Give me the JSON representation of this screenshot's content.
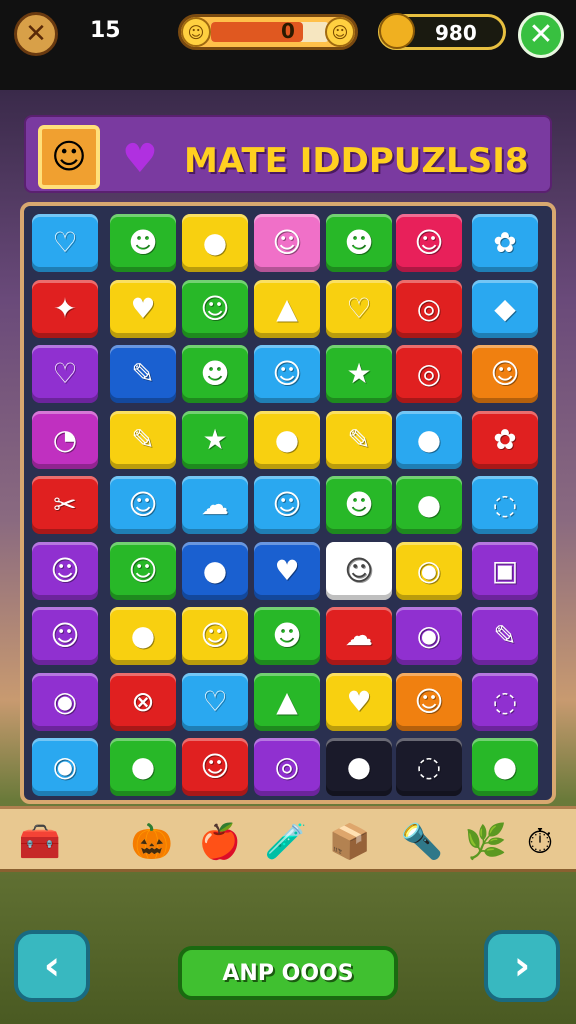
{
  "hud": {
    "moves": "15",
    "meter_value": "0",
    "meter_progress": 0.78,
    "coins": "980",
    "icons": {
      "crate": "crate-icon",
      "face_left": "smiley-icon",
      "face_right": "smiley-icon",
      "coin": "coin-bag-icon",
      "close": "close-icon"
    }
  },
  "banner": {
    "title": "MATE IDDPUZLSI8",
    "logo_icon": "cat-face-icon",
    "heart_icon": "heart-icon"
  },
  "board": {
    "rows": 9,
    "cols": 7,
    "tiles": [
      [
        {
          "c": "#2aa8f0",
          "g": "♡"
        },
        {
          "c": "#28b828",
          "g": "☻"
        },
        {
          "c": "#f8d010",
          "g": "●"
        },
        {
          "c": "#f070c8",
          "g": "☺"
        },
        {
          "c": "#28b828",
          "g": "☻"
        },
        {
          "c": "#e8205a",
          "g": "☺"
        },
        {
          "c": "#2aa8f0",
          "g": "✿"
        }
      ],
      [
        {
          "c": "#e02020",
          "g": "✦"
        },
        {
          "c": "#f8d010",
          "g": "♥"
        },
        {
          "c": "#28b828",
          "g": "☺"
        },
        {
          "c": "#f8d010",
          "g": "▲"
        },
        {
          "c": "#f8d010",
          "g": "♡"
        },
        {
          "c": "#e02020",
          "g": "◎"
        },
        {
          "c": "#2aa8f0",
          "g": "◆"
        }
      ],
      [
        {
          "c": "#9030d0",
          "g": "♡"
        },
        {
          "c": "#1a60d0",
          "g": "✎"
        },
        {
          "c": "#28b828",
          "g": "☻"
        },
        {
          "c": "#2aa8f0",
          "g": "☺"
        },
        {
          "c": "#28b828",
          "g": "★"
        },
        {
          "c": "#e02020",
          "g": "◎"
        },
        {
          "c": "#f08010",
          "g": "☺"
        }
      ],
      [
        {
          "c": "#c030c0",
          "g": "◔"
        },
        {
          "c": "#f8d010",
          "g": "✎"
        },
        {
          "c": "#28b828",
          "g": "★"
        },
        {
          "c": "#f8d010",
          "g": "●"
        },
        {
          "c": "#f8d010",
          "g": "✎"
        },
        {
          "c": "#2aa8f0",
          "g": "●"
        },
        {
          "c": "#e02020",
          "g": "✿"
        }
      ],
      [
        {
          "c": "#e02020",
          "g": "✂"
        },
        {
          "c": "#2aa8f0",
          "g": "☺"
        },
        {
          "c": "#2aa8f0",
          "g": "☁"
        },
        {
          "c": "#2aa8f0",
          "g": "☺"
        },
        {
          "c": "#28b828",
          "g": "☻"
        },
        {
          "c": "#28b828",
          "g": "●"
        },
        {
          "c": "#2aa8f0",
          "g": "◌"
        }
      ],
      [
        {
          "c": "#9030d0",
          "g": "☺"
        },
        {
          "c": "#28b828",
          "g": "☺"
        },
        {
          "c": "#1a60d0",
          "g": "●"
        },
        {
          "c": "#1a60d0",
          "g": "♥"
        },
        {
          "c": "#ffffff",
          "g": "☺"
        },
        {
          "c": "#f8d010",
          "g": "◉"
        },
        {
          "c": "#9030d0",
          "g": "▣"
        }
      ],
      [
        {
          "c": "#9030d0",
          "g": "☺"
        },
        {
          "c": "#f8d010",
          "g": "●"
        },
        {
          "c": "#f8d010",
          "g": "☺"
        },
        {
          "c": "#28b828",
          "g": "☻"
        },
        {
          "c": "#e02020",
          "g": "☁"
        },
        {
          "c": "#9030d0",
          "g": "◉"
        },
        {
          "c": "#9030d0",
          "g": "✎"
        }
      ],
      [
        {
          "c": "#9030d0",
          "g": "◉"
        },
        {
          "c": "#e02020",
          "g": "⊗"
        },
        {
          "c": "#2aa8f0",
          "g": "♡"
        },
        {
          "c": "#28b828",
          "g": "▲"
        },
        {
          "c": "#f8d010",
          "g": "♥"
        },
        {
          "c": "#f08010",
          "g": "☺"
        },
        {
          "c": "#9030d0",
          "g": "◌"
        }
      ],
      [
        {
          "c": "#2aa8f0",
          "g": "◉"
        },
        {
          "c": "#28b828",
          "g": "●"
        },
        {
          "c": "#e02020",
          "g": "☺"
        },
        {
          "c": "#9030d0",
          "g": "◎"
        },
        {
          "c": "#1a1a2a",
          "g": "●"
        },
        {
          "c": "#1a1a2a",
          "g": "◌"
        },
        {
          "c": "#28b828",
          "g": "●"
        }
      ]
    ]
  },
  "shelf": {
    "items": [
      "🧰",
      "🎃",
      "🍎",
      "🧪",
      "📦",
      "🔦",
      "🌿",
      "⏱"
    ]
  },
  "nav": {
    "prev_icon": "chevron-left-icon",
    "next_icon": "chevron-right-icon",
    "play_label": "ANP OOOS"
  }
}
